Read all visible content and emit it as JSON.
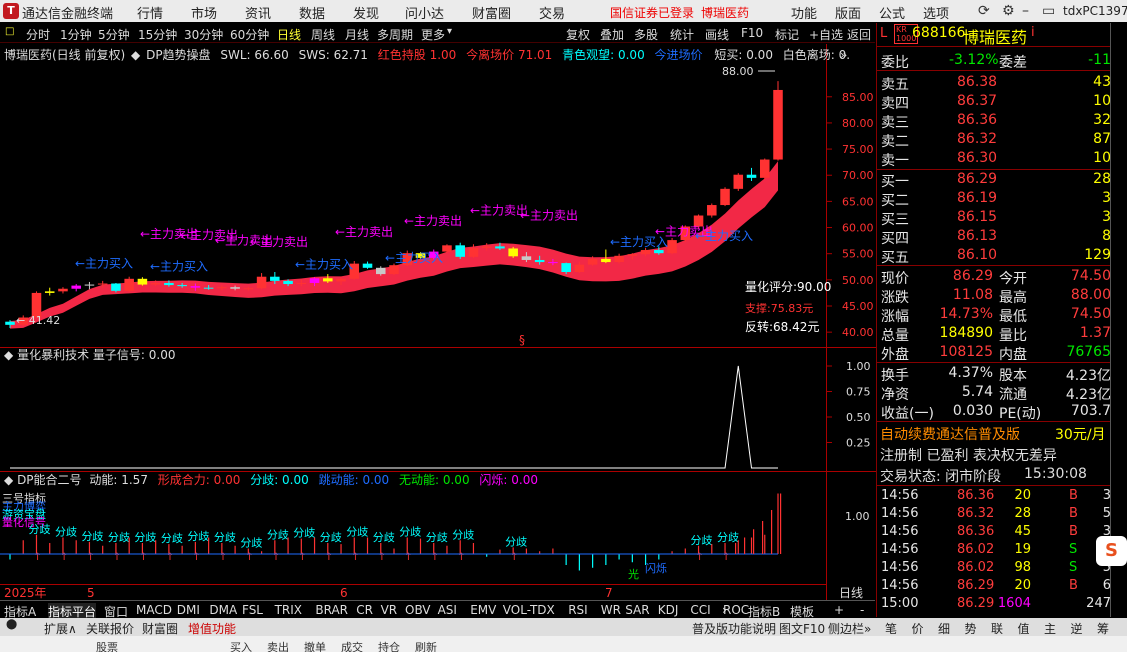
{
  "titlebar": {
    "app_name": "通达信金融终端",
    "menus": [
      "行情",
      "市场",
      "资讯",
      "数据",
      "发现",
      "问小达",
      "财富圈",
      "交易"
    ],
    "login_status": "国信证券已登录",
    "stock_in_title": "博瑞医药",
    "right_menus": [
      "功能",
      "版面",
      "公式",
      "选项"
    ],
    "user": "tdxPC1397"
  },
  "toolbar": {
    "periods": [
      "分时",
      "1分钟",
      "5分钟",
      "15分钟",
      "30分钟",
      "60分钟",
      "日线",
      "周线",
      "月线",
      "多周期",
      "更多"
    ],
    "actions": [
      "复权",
      "叠加",
      "多股",
      "统计",
      "画线",
      "F10",
      "标记",
      "+自选",
      "返回"
    ]
  },
  "main_chart": {
    "info": {
      "stock": "博瑞医药(日线 前复权)",
      "indicator": "DP趋势操盘",
      "swl": "SWL: 66.60",
      "sws": "SWS: 62.71",
      "red_hold": "红色持股 1.00",
      "leave_price": "今离场价 71.01",
      "cyan_watch": "青色观望: 0.00",
      "enter_price": "今进场价",
      "short": "短买: 0.00",
      "white_leave": "白色离场: 0.",
      "arrow": "»"
    },
    "high_label": "88.00",
    "low_label": "41.42",
    "annotations": {
      "sell": "←主力卖出",
      "buy": "←主力买入"
    },
    "score": "量化评分:90.00",
    "support": "支撑:75.83元",
    "reverse": "反转:68.42元",
    "s_mark": "§"
  },
  "chart_data": [
    {
      "type": "candlestick",
      "title": "博瑞医药(日线 前复权)",
      "yticks": [
        "85.00",
        "80.00",
        "75.00",
        "70.00",
        "65.00",
        "60.00",
        "55.00",
        "50.00",
        "45.00",
        "40.00"
      ],
      "ylim": [
        38.5,
        90.5
      ],
      "candles": [
        [
          42.0,
          42.3,
          40.8,
          41.4
        ],
        [
          41.4,
          43.2,
          41.2,
          42.8
        ],
        [
          42.8,
          47.8,
          42.6,
          47.5
        ],
        [
          47.5,
          48.5,
          47.0,
          47.8
        ],
        [
          47.8,
          48.6,
          47.4,
          48.3
        ],
        [
          48.3,
          49.2,
          47.8,
          48.9
        ],
        [
          48.9,
          49.6,
          48.2,
          49.1
        ],
        [
          49.1,
          49.8,
          48.5,
          49.3
        ],
        [
          49.3,
          49.4,
          47.6,
          47.9
        ],
        [
          47.9,
          50.6,
          47.7,
          50.2
        ],
        [
          50.2,
          50.5,
          48.9,
          49.1
        ],
        [
          49.1,
          49.9,
          48.8,
          49.4
        ],
        [
          49.4,
          49.9,
          48.7,
          49.0
        ],
        [
          49.0,
          49.4,
          48.5,
          48.8
        ],
        [
          48.8,
          49.3,
          47.9,
          48.5
        ],
        [
          48.5,
          49.0,
          48.1,
          48.4
        ],
        [
          48.4,
          49.0,
          48.0,
          48.6
        ],
        [
          48.6,
          48.9,
          48.0,
          48.3
        ],
        [
          48.3,
          48.7,
          47.9,
          48.4
        ],
        [
          48.4,
          51.3,
          48.2,
          50.6
        ],
        [
          50.6,
          51.5,
          49.2,
          49.8
        ],
        [
          49.8,
          50.1,
          48.8,
          49.2
        ],
        [
          49.2,
          50.1,
          48.8,
          49.4
        ],
        [
          49.4,
          50.5,
          48.8,
          50.3
        ],
        [
          50.3,
          51.1,
          49.4,
          49.7
        ],
        [
          49.7,
          50.6,
          49.0,
          50.2
        ],
        [
          50.2,
          53.6,
          50.0,
          53.1
        ],
        [
          53.1,
          53.5,
          52.1,
          52.3
        ],
        [
          52.3,
          52.6,
          50.8,
          51.1
        ],
        [
          51.1,
          53.1,
          50.9,
          52.8
        ],
        [
          52.8,
          55.6,
          52.6,
          55.1
        ],
        [
          55.1,
          55.3,
          54.1,
          54.2
        ],
        [
          54.2,
          55.8,
          53.9,
          55.4
        ],
        [
          55.4,
          56.8,
          55.1,
          56.6
        ],
        [
          56.6,
          57.1,
          54.0,
          54.4
        ],
        [
          54.4,
          56.8,
          54.2,
          56.1
        ],
        [
          56.1,
          57.0,
          55.6,
          56.4
        ],
        [
          56.4,
          57.1,
          55.7,
          56.0
        ],
        [
          56.0,
          56.3,
          54.2,
          54.5
        ],
        [
          54.5,
          55.3,
          53.4,
          53.8
        ],
        [
          53.8,
          54.6,
          52.9,
          53.4
        ],
        [
          53.4,
          54.0,
          52.8,
          53.2
        ],
        [
          53.2,
          53.3,
          51.1,
          51.5
        ],
        [
          51.5,
          53.5,
          51.3,
          52.9
        ],
        [
          52.9,
          54.5,
          52.7,
          54.0
        ],
        [
          54.0,
          55.8,
          53.2,
          53.4
        ],
        [
          53.4,
          55.0,
          53.1,
          54.6
        ],
        [
          54.6,
          55.1,
          53.9,
          54.9
        ],
        [
          54.9,
          56.1,
          54.5,
          55.7
        ],
        [
          55.7,
          56.4,
          54.8,
          55.1
        ],
        [
          55.1,
          58.0,
          54.9,
          57.6
        ],
        [
          57.6,
          60.4,
          57.3,
          60.2
        ],
        [
          60.2,
          62.5,
          59.8,
          62.3
        ],
        [
          62.3,
          64.6,
          61.9,
          64.3
        ],
        [
          64.3,
          67.7,
          64.1,
          67.4
        ],
        [
          67.4,
          70.4,
          67.0,
          70.1
        ],
        [
          70.1,
          71.4,
          68.9,
          69.5
        ],
        [
          69.5,
          73.2,
          69.2,
          73.0
        ],
        [
          73.0,
          88.0,
          72.8,
          86.3
        ]
      ]
    },
    {
      "type": "line",
      "title": "量化暴利技术",
      "series_label": "量子信号: 0.00",
      "yticks": [
        "1.00",
        "0.75",
        "0.50",
        "0.25"
      ],
      "ylim": [
        0,
        1
      ],
      "signal": [
        0,
        0,
        0,
        0,
        0,
        0,
        0,
        0,
        0,
        0,
        0,
        0,
        0,
        0,
        0,
        0,
        0,
        0,
        0,
        0,
        0,
        0,
        0,
        0,
        0,
        0,
        0,
        0,
        0,
        0,
        0,
        0,
        0,
        0,
        0,
        0,
        0,
        0,
        0,
        0,
        0,
        0,
        0,
        0,
        0,
        0,
        0,
        0,
        0,
        0,
        0,
        0,
        0,
        0,
        0,
        1,
        0,
        0,
        0
      ]
    },
    {
      "type": "bar",
      "title": "DP能合二号",
      "labels": {
        "power": "动能: 1.57",
        "combine": "形成合力: 0.00",
        "diverge": "分歧: 0.00",
        "jump": "跳动能: 0.00",
        "none": "无动能: 0.00",
        "flash": "闪烁: 0.00"
      },
      "left_text": [
        "三号指标",
        "主力博弈",
        "游资宝盘",
        "量化信号"
      ],
      "ytick": "1.00",
      "divergence": "分歧",
      "shimmer": "闪烁",
      "glow": "光",
      "values": [
        -0.1,
        0.25,
        0.35,
        0.2,
        0.3,
        0.25,
        0.22,
        0.15,
        0.2,
        0.3,
        0.2,
        0.25,
        0.18,
        0.15,
        0.22,
        0.3,
        0.2,
        0.15,
        0.1,
        0.05,
        0.25,
        0.3,
        0.28,
        0.3,
        0.2,
        0.18,
        0.3,
        0.3,
        0.2,
        0.1,
        0.3,
        0.28,
        0.2,
        0.15,
        0.25,
        0.2,
        -0.05,
        0.08,
        0.12,
        0.1,
        0.05,
        0.1,
        -0.2,
        -0.3,
        -0.25,
        -0.2,
        -0.1,
        -0.15,
        -0.2,
        -0.1,
        0.05,
        0.1,
        0.15,
        0.18,
        0.2,
        0.25,
        0.3,
        0.35,
        1.1
      ]
    }
  ],
  "xaxis": {
    "year": "2025年",
    "m5": "5",
    "m6": "6",
    "m7": "7",
    "mode": "日线"
  },
  "quote": {
    "badge_top": "KR",
    "badge_bot": "1000",
    "letter": "L",
    "code": "688166",
    "name": "博瑞医药",
    "info": "i",
    "webi_label": "委比",
    "webi": "-3.12%",
    "weicha_label": "委差",
    "weicha": "-11",
    "asks": [
      {
        "label": "卖五",
        "price": "86.38",
        "vol": "43"
      },
      {
        "label": "卖四",
        "price": "86.37",
        "vol": "10"
      },
      {
        "label": "卖三",
        "price": "86.36",
        "vol": "32"
      },
      {
        "label": "卖二",
        "price": "86.32",
        "vol": "87"
      },
      {
        "label": "卖一",
        "price": "86.30",
        "vol": "10"
      }
    ],
    "bids": [
      {
        "label": "买一",
        "price": "86.29",
        "vol": "28"
      },
      {
        "label": "买二",
        "price": "86.19",
        "vol": "3"
      },
      {
        "label": "买三",
        "price": "86.15",
        "vol": "3"
      },
      {
        "label": "买四",
        "price": "86.13",
        "vol": "8"
      },
      {
        "label": "买五",
        "price": "86.10",
        "vol": "129"
      }
    ],
    "stats": [
      {
        "l1": "现价",
        "v1": "86.29",
        "l2": "今开",
        "v2": "74.50"
      },
      {
        "l1": "涨跌",
        "v1": "11.08",
        "l2": "最高",
        "v2": "88.00"
      },
      {
        "l1": "涨幅",
        "v1": "14.73%",
        "l2": "最低",
        "v2": "74.50"
      },
      {
        "l1": "总量",
        "v1": "184890",
        "l2": "量比",
        "v2": "1.37"
      },
      {
        "l1": "外盘",
        "v1": "108125",
        "l2": "内盘",
        "v2": "76765"
      }
    ],
    "fund": [
      {
        "l1": "换手",
        "v1": "4.37%",
        "l2": "股本",
        "v2": "4.23亿"
      },
      {
        "l1": "净资",
        "v1": "5.74",
        "l2": "流通",
        "v2": "4.23亿"
      },
      {
        "l1": "收益(一)",
        "v1": "0.030",
        "l2": "PE(动)",
        "v2": "703.7"
      }
    ],
    "promo1": "自动续费通达信普及版",
    "promo_price": "30元/月",
    "promo2": "注册制 已盈利 表决权无差异",
    "status_label": "交易状态: 闭市阶段",
    "status_time": "15:30:08",
    "ticks": [
      {
        "t": "14:56",
        "p": "86.36",
        "v": "20",
        "d": "B",
        "n": "3"
      },
      {
        "t": "14:56",
        "p": "86.32",
        "v": "28",
        "d": "B",
        "n": "5"
      },
      {
        "t": "14:56",
        "p": "86.36",
        "v": "45",
        "d": "B",
        "n": "3"
      },
      {
        "t": "14:56",
        "p": "86.02",
        "v": "19",
        "d": "S",
        "n": "4"
      },
      {
        "t": "14:56",
        "p": "86.02",
        "v": "98",
        "d": "S",
        "n": "5"
      },
      {
        "t": "14:56",
        "p": "86.29",
        "v": "20",
        "d": "B",
        "n": "6"
      },
      {
        "t": "15:00",
        "p": "86.29",
        "v": "1604",
        "d": "",
        "n": "247"
      }
    ]
  },
  "bottom": {
    "tabs1": [
      "指标A",
      "指标平台",
      "窗口",
      "MACD",
      "DMI",
      "DMA",
      "FSL",
      "TRIX",
      "BRAR",
      "CR",
      "VR",
      "OBV",
      "ASI",
      "EMV",
      "VOL-TDX",
      "RSI",
      "WR",
      "SAR",
      "KDJ",
      "CCI",
      "ROC"
    ],
    "more": "›",
    "indicator_b": "指标B",
    "template": "模板",
    "plus": "+",
    "minus": "-",
    "tabs2": [
      "扩展∧",
      "关联报价",
      "财富圈",
      "增值功能"
    ],
    "help": "普及版功能说明",
    "f10": "图文F10",
    "sidebar": "侧边栏»",
    "tabs2_right": [
      "笔",
      "价",
      "细",
      "势",
      "联",
      "值",
      "主",
      "逆",
      "筹"
    ],
    "tabs3": [
      "股票",
      "买入",
      "卖出",
      "撤单",
      "成交",
      "持仓",
      "刷新"
    ]
  },
  "colors": {
    "up": "#ff3232",
    "down": "#00ffff",
    "yellow": "#ffff00",
    "magenta": "#ff00ff",
    "white": "#ffffff",
    "band": "#ff2a4a"
  }
}
